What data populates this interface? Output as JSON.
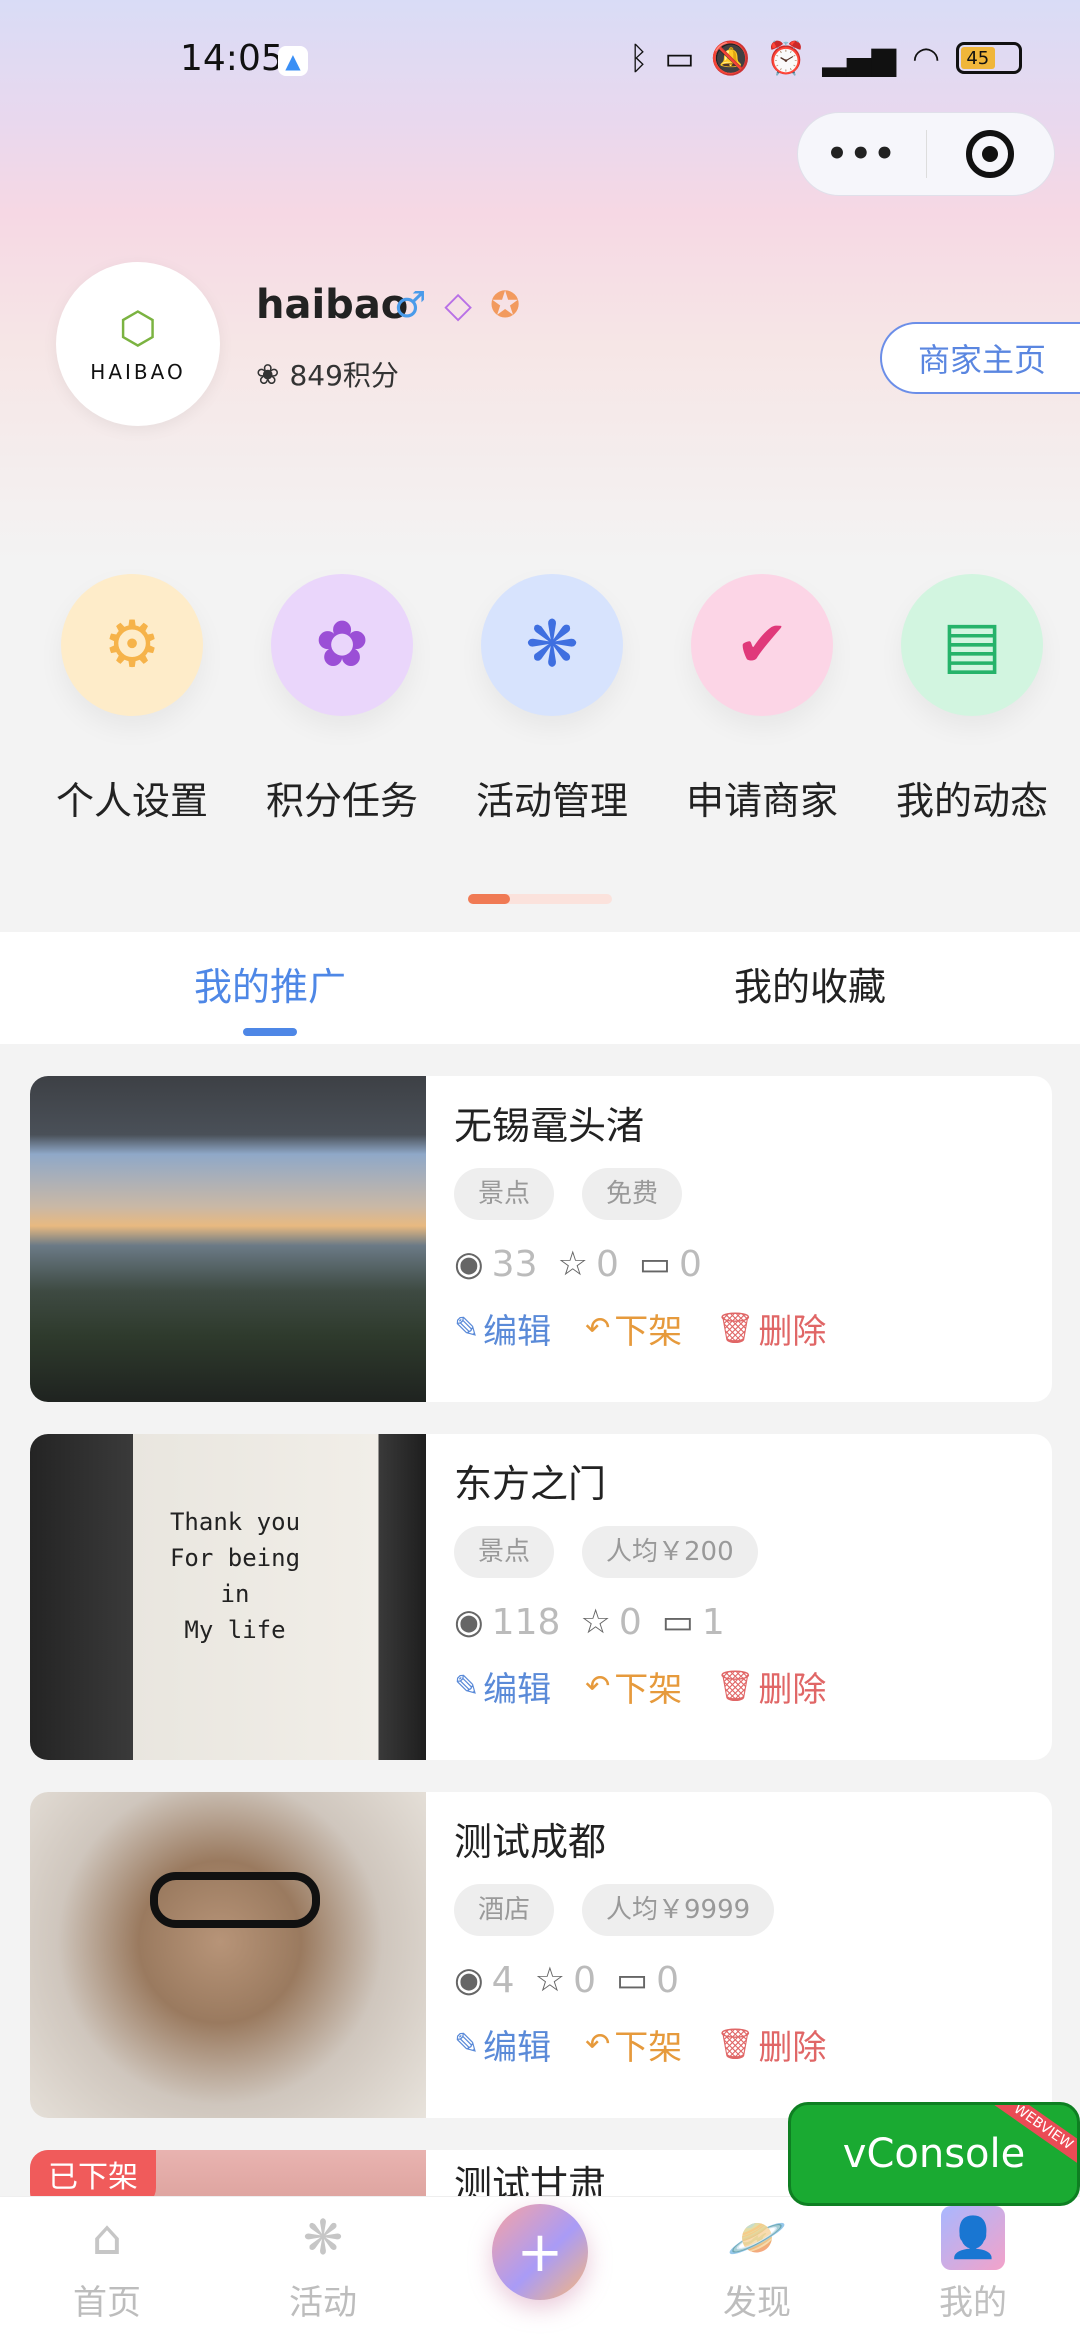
{
  "status_bar": {
    "time": "14:05",
    "battery": "45"
  },
  "capsule": {
    "more": "•••"
  },
  "profile": {
    "avatar_text": "HAIBAO",
    "username": "haibao",
    "points": "849积分",
    "merchant_button": "商家主页"
  },
  "quick_actions": [
    {
      "label": "个人设置",
      "icon": "gear-icon",
      "color": "#f6b34a",
      "bg": "#feecc9"
    },
    {
      "label": "积分任务",
      "icon": "tulip-icon",
      "color": "#9b4fd6",
      "bg": "#ead6fb"
    },
    {
      "label": "活动管理",
      "icon": "snowflake-icon",
      "color": "#3f6fe0",
      "bg": "#d7e3fd"
    },
    {
      "label": "申请商家",
      "icon": "verified-badge-icon",
      "color": "#e0397a",
      "bg": "#fcd5e6"
    },
    {
      "label": "我的动态",
      "icon": "message-icon",
      "color": "#26b36a",
      "bg": "#d2f5e0"
    }
  ],
  "tabs": {
    "promo": "我的推广",
    "favorites": "我的收藏"
  },
  "items": [
    {
      "title": "无锡鼋头渚",
      "tags": [
        "景点",
        "免费"
      ],
      "views": "33",
      "stars": "0",
      "comments": "0"
    },
    {
      "title": "东方之门",
      "tags": [
        "景点",
        "人均￥200"
      ],
      "views": "118",
      "stars": "0",
      "comments": "1",
      "poster_lines": [
        "Thank you",
        "For being in",
        "My life"
      ]
    },
    {
      "title": "测试成都",
      "tags": [
        "酒店",
        "人均￥9999"
      ],
      "views": "4",
      "stars": "0",
      "comments": "0"
    },
    {
      "title": "测试甘肃",
      "badge": "已下架"
    }
  ],
  "actions": {
    "edit": "编辑",
    "offline": "下架",
    "delete": "删除"
  },
  "vconsole": {
    "label": "vConsole",
    "ribbon": "WEBVIEW"
  },
  "tabbar": {
    "home": "首页",
    "activity": "活动",
    "discover": "发现",
    "mine": "我的"
  }
}
